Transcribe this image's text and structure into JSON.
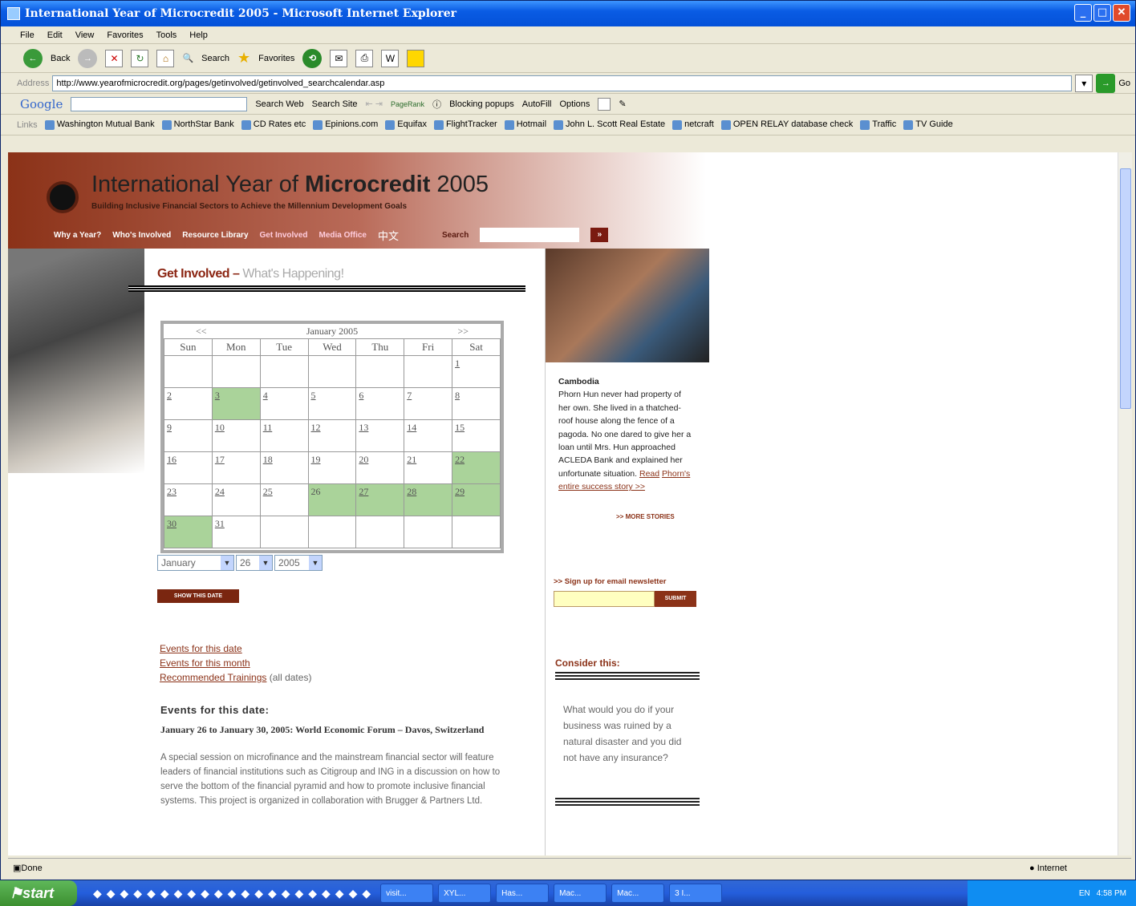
{
  "window": {
    "title": "International Year of Microcredit 2005 - Microsoft Internet Explorer"
  },
  "menu": [
    "File",
    "Edit",
    "View",
    "Favorites",
    "Tools",
    "Help"
  ],
  "toolbar": {
    "back": "Back",
    "search": "Search",
    "favorites": "Favorites"
  },
  "address": {
    "label": "Address",
    "url": "http://www.yearofmicrocredit.org/pages/getinvolved/getinvolved_searchcalendar.asp",
    "go": "Go"
  },
  "google": {
    "logo": "Google",
    "search_web": "Search Web",
    "search_site": "Search Site",
    "pagerank": "PageRank",
    "blocking": "Blocking popups",
    "autofill": "AutoFill",
    "options": "Options"
  },
  "links": {
    "label": "Links",
    "items": [
      "Washington Mutual Bank",
      "NorthStar Bank",
      "CD Rates etc",
      "Epinions.com",
      "Equifax",
      "FlightTracker",
      "Hotmail",
      "John L. Scott Real Estate",
      "netcraft",
      "OPEN RELAY database check",
      "Traffic",
      "TV Guide"
    ]
  },
  "site": {
    "title_pre": "International Year of ",
    "title_bold": "Microcredit",
    "title_post": " 2005",
    "subtitle": "Building Inclusive Financial Sectors to Achieve the Millennium Development Goals",
    "nav": [
      "Why a Year?",
      "Who's Involved",
      "Resource Library",
      "Get Involved",
      "Media Office",
      "中文"
    ],
    "search_label": "Search",
    "search_go": "»"
  },
  "page": {
    "heading": "Get Involved –",
    "heading_sub": "What's Happening!"
  },
  "calendar": {
    "prev": "<<",
    "next": ">>",
    "month_label": "January 2005",
    "days": [
      "Sun",
      "Mon",
      "Tue",
      "Wed",
      "Thu",
      "Fri",
      "Sat"
    ],
    "weeks": [
      [
        "",
        "",
        "",
        "",
        "",
        "",
        "1"
      ],
      [
        "2",
        "3",
        "4",
        "5",
        "6",
        "7",
        "8"
      ],
      [
        "9",
        "10",
        "11",
        "12",
        "13",
        "14",
        "15"
      ],
      [
        "16",
        "17",
        "18",
        "19",
        "20",
        "21",
        "22"
      ],
      [
        "23",
        "24",
        "25",
        "26",
        "27",
        "28",
        "29"
      ],
      [
        "30",
        "31",
        "",
        "",
        "",
        "",
        ""
      ]
    ],
    "highlighted": [
      "3",
      "22",
      "26",
      "27",
      "28",
      "29",
      "30"
    ]
  },
  "selects": {
    "month": "January",
    "day": "26",
    "year": "2005"
  },
  "show_date_button": "SHOW THIS DATE",
  "event_links": {
    "date": "Events for this date",
    "month": "Events for this month",
    "trainings": "Recommended Trainings",
    "trainings_note": "(all dates)"
  },
  "events": {
    "heading": "Events for this date:",
    "title": "January 26 to January 30, 2005: World Economic Forum – Davos, Switzerland",
    "desc": "A special session on microfinance and the mainstream financial sector will feature leaders of financial institutions such as Citigroup and ING in a discussion on how to serve the bottom of the financial pyramid and how to promote inclusive financial systems. This project is organized in collaboration with Brugger & Partners Ltd."
  },
  "sidebar": {
    "story_title": "Cambodia",
    "story_text": "Phorn Hun never had property of her own. She lived in a thatched-roof house along the fence of a pagoda. No one dared to give her a loan until Mrs. Hun approached ACLEDA Bank and explained her unfortunate situation. ",
    "story_link1": "Read",
    "story_link2": "Phorn's entire success story >>",
    "more": ">> MORE STORIES",
    "newsletter": ">> Sign up for email newsletter",
    "submit": "SUBMIT",
    "consider": "Consider this:",
    "question": "What would you do if your business was ruined by a natural disaster and you did not have any insurance?"
  },
  "status": {
    "text": "Done",
    "zone": "Internet"
  },
  "taskbar": {
    "start": "start",
    "tasks": [
      "visit...",
      "XYL...",
      "Has...",
      "Mac...",
      "Mac...",
      "3 I..."
    ],
    "lang": "EN",
    "clock": "4:58 PM"
  }
}
